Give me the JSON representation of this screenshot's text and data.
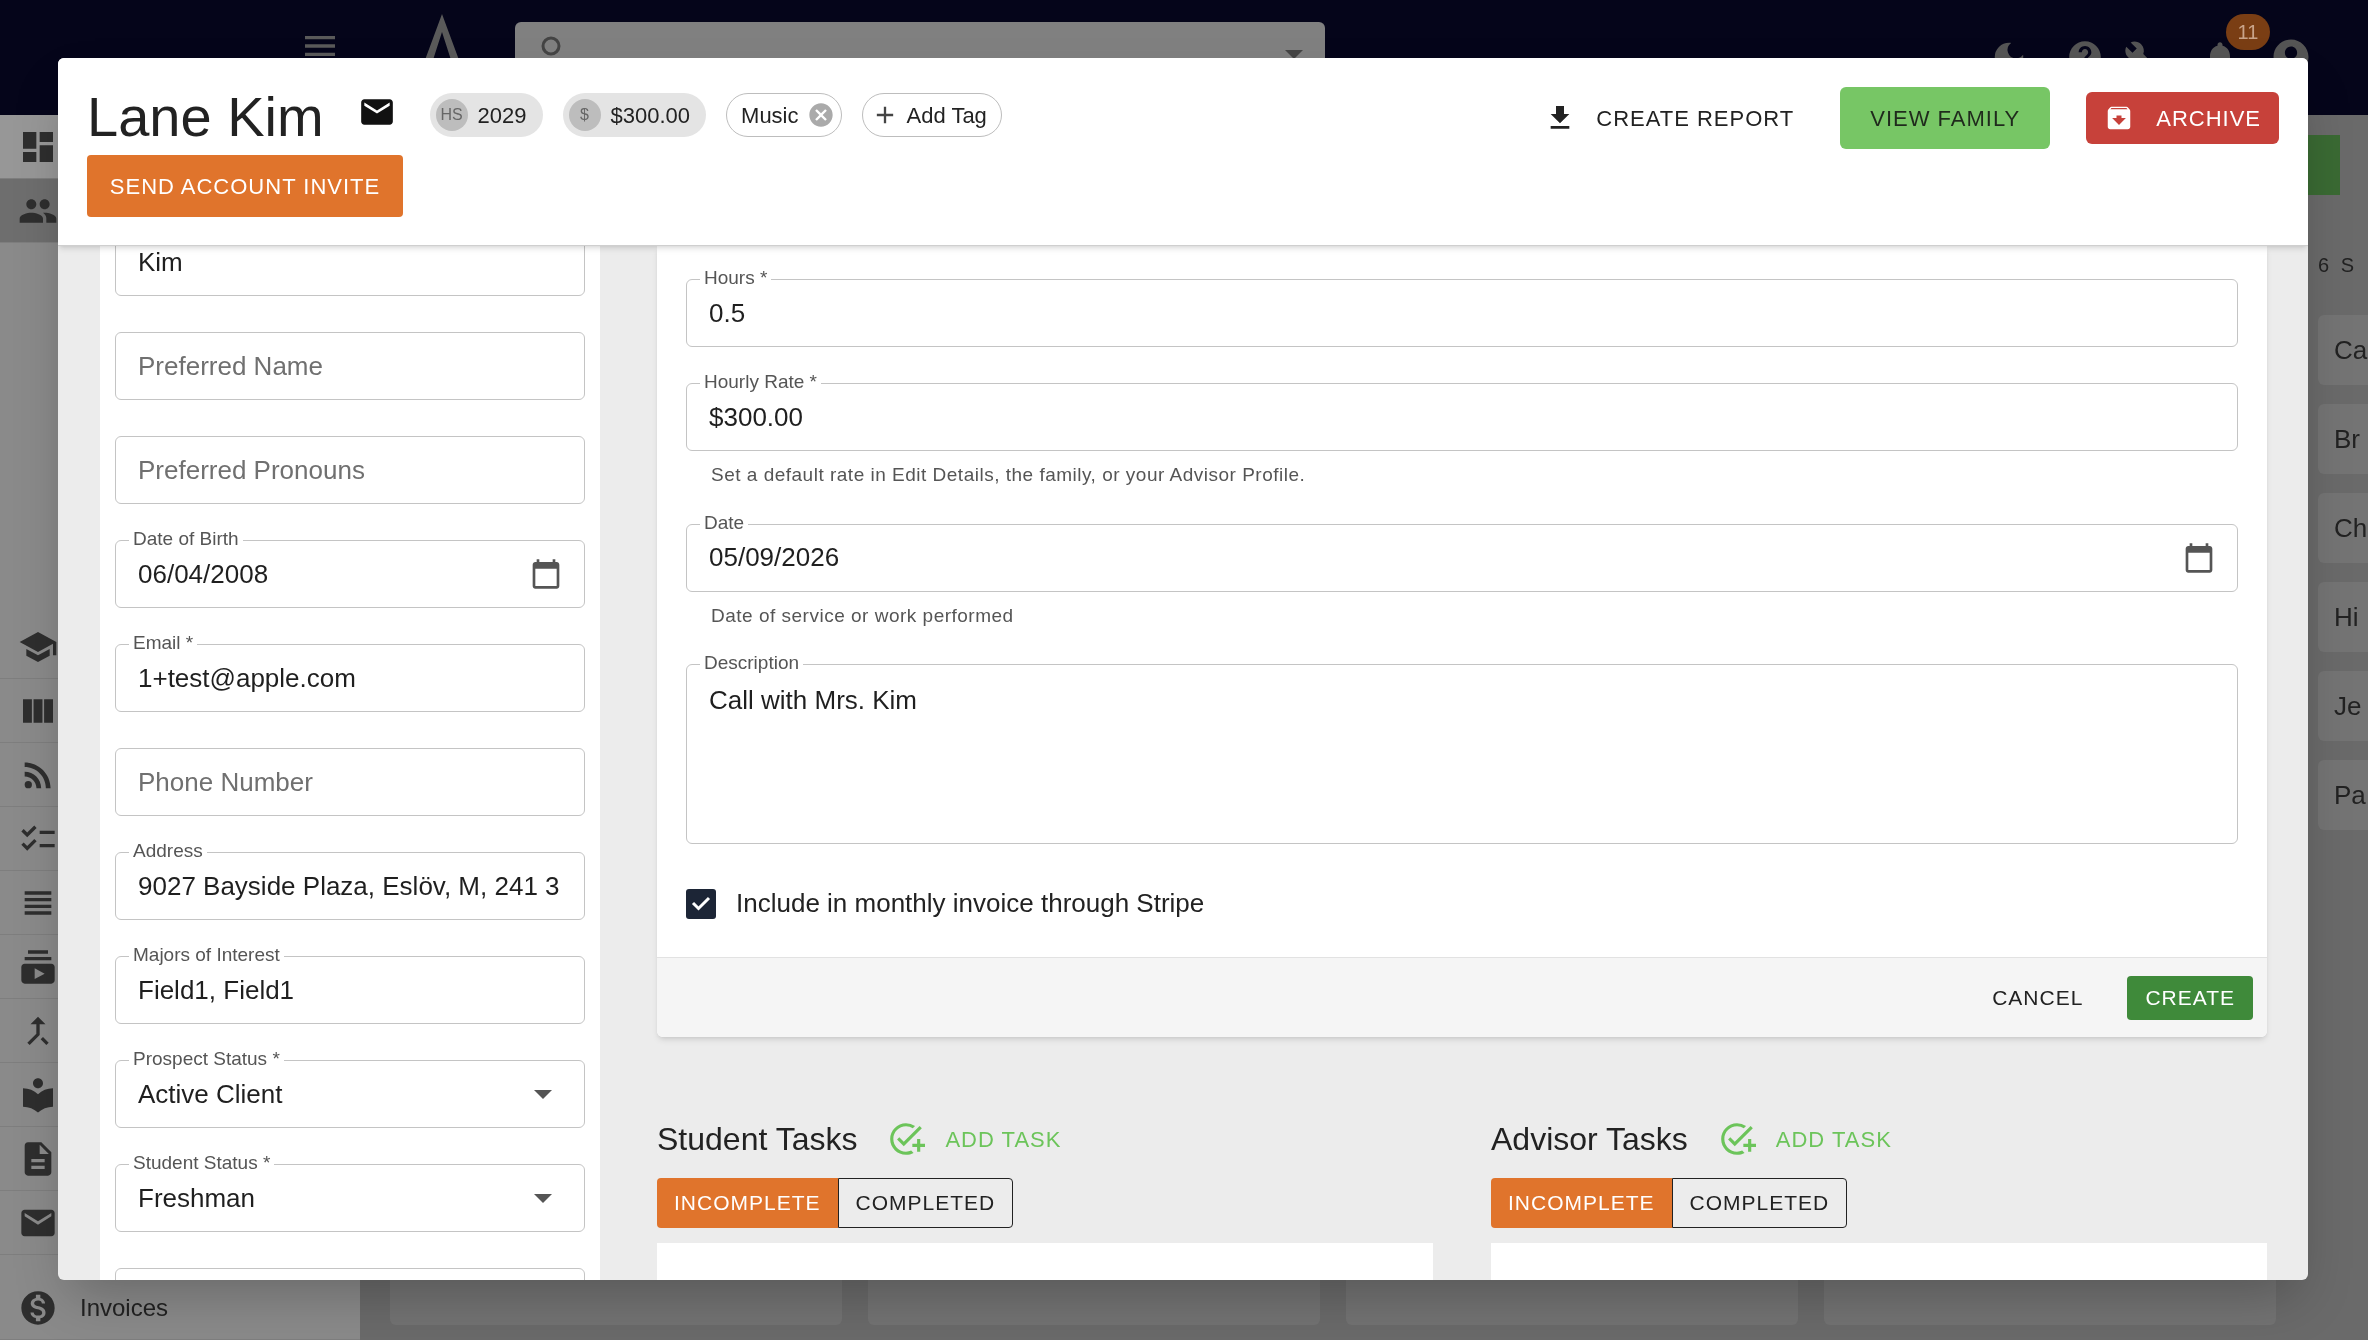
{
  "app_bar": {
    "notification_count": "11"
  },
  "sidebar": {
    "items": [
      {
        "selected": false
      },
      {
        "selected": true
      },
      {
        "selected": false
      },
      {
        "selected": false
      },
      {
        "selected": false
      },
      {
        "selected": false
      },
      {
        "selected": false
      },
      {
        "selected": false
      },
      {
        "selected": false
      },
      {
        "selected": false
      },
      {
        "selected": false
      },
      {
        "selected": false
      },
      {
        "selected": false,
        "label": "Invoices"
      }
    ]
  },
  "list_panel": {
    "heading": "6 S",
    "items": [
      "Ca",
      "Br",
      "Ch",
      "Hi",
      "Je",
      "Pa"
    ]
  },
  "student": {
    "name": "Lane Kim",
    "chips": [
      {
        "kind": "avatar",
        "avatar": "HS",
        "label": "2029"
      },
      {
        "kind": "avatar",
        "avatar": "$",
        "label": "$300.00"
      },
      {
        "kind": "tag",
        "label": "Music"
      },
      {
        "kind": "add",
        "label": "Add Tag"
      }
    ],
    "invite_button": "SEND ACCOUNT INVITE",
    "actions": [
      {
        "kind": "text",
        "label": "CREATE REPORT"
      },
      {
        "kind": "success",
        "label": "VIEW FAMILY"
      },
      {
        "kind": "danger",
        "label": "ARCHIVE"
      }
    ]
  },
  "profile_fields": [
    {
      "kind": "text",
      "value": "Kim"
    },
    {
      "kind": "text",
      "placeholder": "Preferred Name"
    },
    {
      "kind": "text",
      "placeholder": "Preferred Pronouns"
    },
    {
      "kind": "date",
      "label": "Date of Birth",
      "value": "06/04/2008"
    },
    {
      "kind": "text",
      "label": "Email *",
      "value": "1+test@apple.com"
    },
    {
      "kind": "text",
      "placeholder": "Phone Number"
    },
    {
      "kind": "text",
      "label": "Address",
      "value": "9027 Bayside Plaza, Eslöv, M, 241 3"
    },
    {
      "kind": "text",
      "label": "Majors of Interest",
      "value": "Field1, Field1"
    },
    {
      "kind": "select",
      "label": "Prospect Status *",
      "value": "Active Client"
    },
    {
      "kind": "select",
      "label": "Student Status *",
      "value": "Freshman"
    }
  ],
  "time_entry": {
    "fields": [
      {
        "kind": "text",
        "label": "Hours *",
        "value": "0.5"
      },
      {
        "kind": "text",
        "label": "Hourly Rate *",
        "value": "$300.00",
        "helper": "Set a default rate in Edit Details, the family, or your Advisor Profile."
      },
      {
        "kind": "date",
        "label": "Date",
        "value": "05/09/2026",
        "helper": "Date of service or work performed"
      },
      {
        "kind": "textarea",
        "label": "Description",
        "value": "Call with Mrs. Kim"
      }
    ],
    "invoice_checkbox": {
      "label": "Include in monthly invoice through Stripe",
      "checked": true
    },
    "buttons": [
      {
        "kind": "text",
        "label": "CANCEL"
      },
      {
        "kind": "primary",
        "label": "CREATE"
      }
    ]
  },
  "task_panels": [
    {
      "title": "Student Tasks",
      "add_label": "ADD TASK",
      "tabs": [
        {
          "label": "INCOMPLETE",
          "selected": true
        },
        {
          "label": "COMPLETED",
          "selected": false
        }
      ]
    },
    {
      "title": "Advisor Tasks",
      "add_label": "ADD TASK",
      "tabs": [
        {
          "label": "INCOMPLETE",
          "selected": true
        },
        {
          "label": "COMPLETED",
          "selected": false
        }
      ]
    }
  ]
}
